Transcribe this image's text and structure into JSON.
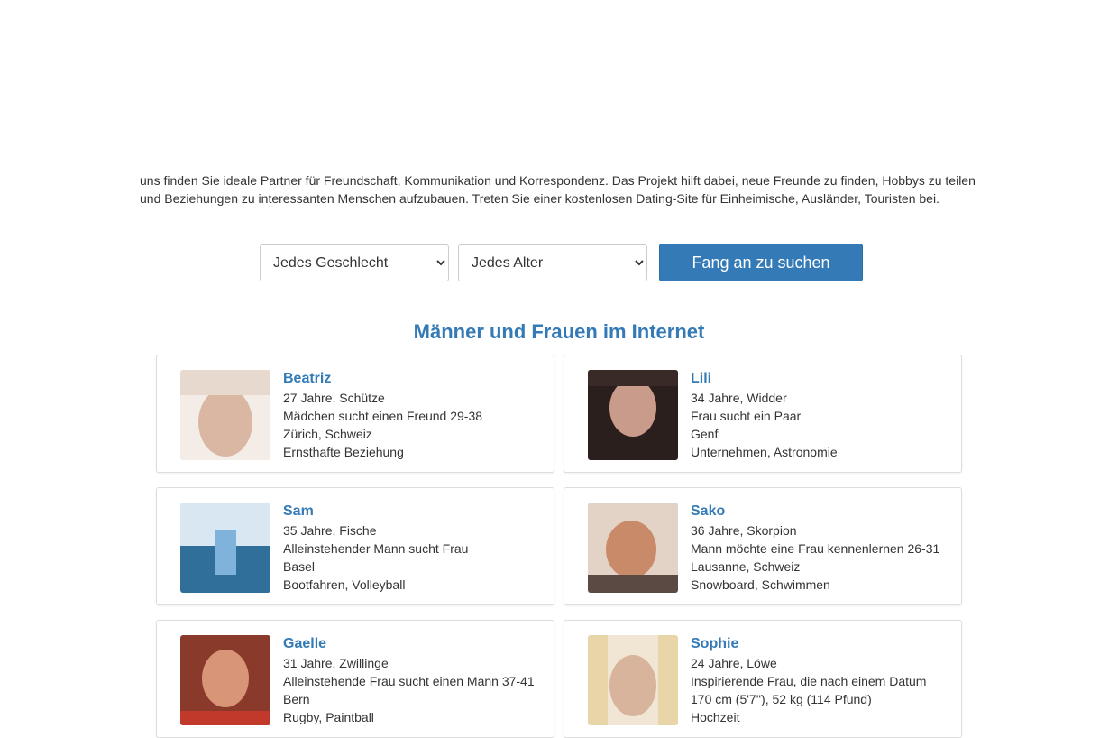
{
  "intro": {
    "line1": "uns finden Sie ideale Partner für Freundschaft, Kommunikation und Korrespondenz. Das Projekt hilft dabei, neue Freunde zu finden, Hobbys zu teilen",
    "line2": "und Beziehungen zu interessanten Menschen aufzubauen. Treten Sie einer kostenlosen Dating-Site für Einheimische, Ausländer, Touristen bei."
  },
  "search": {
    "gender_selected": "Jedes Geschlecht",
    "age_selected": "Jedes Alter",
    "button_label": "Fang an zu suchen"
  },
  "section_title": "Männer und Frauen im Internet",
  "profiles": [
    {
      "name": "Beatriz",
      "age_sign": "27 Jahre, Schütze",
      "tagline": "Mädchen sucht einen Freund 29-38",
      "location": "Zürich, Schweiz",
      "extra": "Ernsthafte Beziehung",
      "colors": [
        "#e8d9cf",
        "#d9b7a3",
        "#f4ece6"
      ]
    },
    {
      "name": "Lili",
      "age_sign": "34 Jahre, Widder",
      "tagline": "Frau sucht ein Paar",
      "location": "Genf",
      "extra": "Unternehmen, Astronomie",
      "colors": [
        "#3a2a27",
        "#c89b8b",
        "#2b1f1e"
      ]
    },
    {
      "name": "Sam",
      "age_sign": "35 Jahre, Fische",
      "tagline": "Alleinstehender Mann sucht Frau",
      "location": "Basel",
      "extra": "Bootfahren, Volleyball",
      "colors": [
        "#7fb3dc",
        "#2f6f9a",
        "#d9e7f2"
      ]
    },
    {
      "name": "Sako",
      "age_sign": "36 Jahre, Skorpion",
      "tagline": "Mann möchte eine Frau kennenlernen 26-31",
      "location": "Lausanne, Schweiz",
      "extra": "Snowboard, Schwimmen",
      "colors": [
        "#c98a6a",
        "#5b4a44",
        "#e3d2c6"
      ]
    },
    {
      "name": "Gaelle",
      "age_sign": "31 Jahre, Zwillinge",
      "tagline": "Alleinstehende Frau sucht einen Mann 37-41",
      "location": "Bern",
      "extra": "Rugby, Paintball",
      "colors": [
        "#8a3a2a",
        "#d89578",
        "#c0392b"
      ]
    },
    {
      "name": "Sophie",
      "age_sign": "24 Jahre, Löwe",
      "tagline": "Inspirierende Frau, die nach einem Datum",
      "location": "170 cm (5'7''), 52 kg (114 Pfund)",
      "extra": "Hochzeit",
      "colors": [
        "#e9d6a8",
        "#d8b49c",
        "#f1e6d4"
      ]
    }
  ]
}
